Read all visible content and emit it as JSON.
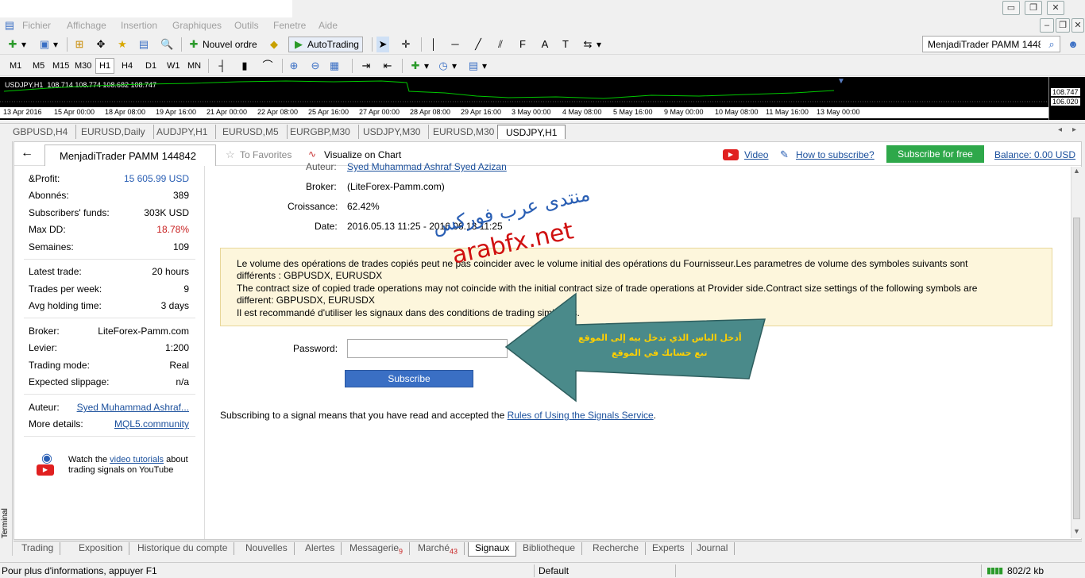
{
  "menu": [
    "Fichier",
    "Affichage",
    "Insertion",
    "Graphiques",
    "Outils",
    "Fenetre",
    "Aide"
  ],
  "toolbar": {
    "new_order": "Nouvel ordre",
    "autotrading": "AutoTrading",
    "search_value": "MenjadiTrader PAMM 1448"
  },
  "timeframes": [
    "M1",
    "M5",
    "M15",
    "M30",
    "H1",
    "H4",
    "D1",
    "W1",
    "MN"
  ],
  "chart": {
    "symbol": "USDJPY,H1  108.714 108.774 108.682 108.747",
    "price_high": "108.747",
    "price_low": "106.020",
    "dates": [
      "13 Apr 2016",
      "15 Apr 00:00",
      "18 Apr 08:00",
      "19 Apr 16:00",
      "21 Apr 00:00",
      "22 Apr 08:00",
      "25 Apr 16:00",
      "27 Apr 00:00",
      "28 Apr 08:00",
      "29 Apr 16:00",
      "3 May 00:00",
      "4 May 08:00",
      "5 May 16:00",
      "9 May 00:00",
      "10 May 08:00",
      "11 May 16:00",
      "13 May 00:00"
    ],
    "line_color": "#00c800"
  },
  "chart_tabs": [
    "GBPUSD,H4",
    "EURUSD,Daily",
    "AUDJPY,H1",
    "EURUSD,M5",
    "EURGBP,M30",
    "USDJPY,M30",
    "EURUSD,M30",
    "USDJPY,H1"
  ],
  "signal": {
    "back": "←",
    "tab_title": "MenjadiTrader PAMM 144842",
    "favorites": "To Favorites",
    "visualize": "Visualize on Chart",
    "video": "Video",
    "how_subscribe": "How to subscribe?",
    "subscribe_free": "Subscribe for free",
    "balance": "Balance: 0.00 USD"
  },
  "stats": {
    "profit_label": "&Profit:",
    "profit_value": "15 605.99 USD",
    "subs_label": "Abonnés:",
    "subs_value": "389",
    "funds_label": "Subscribers' funds:",
    "funds_value": "303K USD",
    "maxdd_label": "Max DD:",
    "maxdd_value": "18.78%",
    "weeks_label": "Semaines:",
    "weeks_value": "109",
    "latest_label": "Latest trade:",
    "latest_value": "20 hours",
    "tpw_label": "Trades per week:",
    "tpw_value": "9",
    "hold_label": "Avg holding time:",
    "hold_value": "3 days",
    "broker_label": "Broker:",
    "broker_value": "LiteForex-Pamm.com",
    "lev_label": "Levier:",
    "lev_value": "1:200",
    "mode_label": "Trading mode:",
    "mode_value": "Real",
    "slip_label": "Expected slippage:",
    "slip_value": "n/a",
    "author_label": "Auteur:",
    "author_value": "Syed Muhammad Ashraf...",
    "more_label": "More details:",
    "more_value": "MQL5.community",
    "yt_pre": "Watch the ",
    "yt_link": "video tutorials",
    "yt_post": " about",
    "yt_line2": "trading signals on YouTube"
  },
  "details": {
    "author_label": "Auteur:",
    "author_value": "Syed Muhammad Ashraf Syed Azizan",
    "broker_label": "Broker:",
    "broker_value": "(LiteForex-Pamm.com)",
    "growth_label": "Croissance:",
    "growth_value": "62.42%",
    "date_label": "Date:",
    "date_value": "2016.05.13 11:25 - 2016.06.13 11:25"
  },
  "warning": {
    "line1": "Le volume des opérations de trades copiés peut ne pas coincider avec le volume initial des opérations du Fournisseur.Les parametres de volume des symboles suivants sont",
    "line2": "différents : GBPUSDX, EURUSDX",
    "line3": "The contract size of copied trade operations may not coincide with the initial contract size of trade operations at Provider side.Contract size settings of the following symbols are",
    "line4": "different: GBPUSDX, EURUSDX",
    "line5": "Il est recommandé d'utiliser les signaux dans des conditions de trading similaires."
  },
  "form": {
    "password_label": "Password:",
    "password_value": "",
    "subscribe": "Subscribe",
    "note_pre": "Subscribing to a signal means that you have read and accepted the ",
    "note_link": "Rules of Using the Signals Service",
    "note_post": "."
  },
  "watermark": {
    "arabic": "منتدى عرب فوركس",
    "site": "arabfx.net",
    "arrow_line1": "أدخل الباس الذي تدخل بيه إلى الموقع",
    "arrow_line2": "تبع حسابك في الموقع"
  },
  "terminal_label": "Terminal",
  "bottom_tabs": [
    {
      "label": "Trading"
    },
    {
      "label": "Exposition"
    },
    {
      "label": "Historique du compte"
    },
    {
      "label": "Nouvelles"
    },
    {
      "label": "Alertes"
    },
    {
      "label": "Messagerie",
      "badge": "9"
    },
    {
      "label": "Marché",
      "badge": "43"
    },
    {
      "label": "Signaux"
    },
    {
      "label": "Bibliotheque"
    },
    {
      "label": "Recherche"
    },
    {
      "label": "Experts"
    },
    {
      "label": "Journal"
    }
  ],
  "status": {
    "help": "Pour plus d'informations, appuyer F1",
    "profile": "Default",
    "traffic": "802/2 kb"
  }
}
